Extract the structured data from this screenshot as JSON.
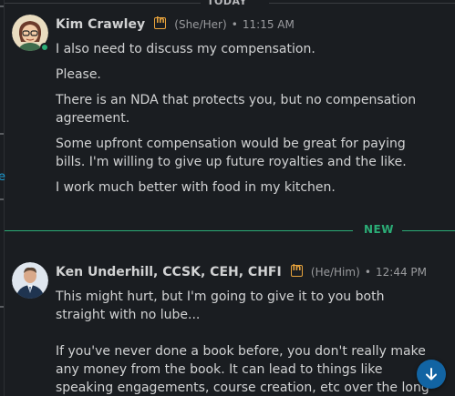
{
  "date_divider": {
    "label": "TODAY"
  },
  "edge": {
    "link_fragment": "e"
  },
  "messages": [
    {
      "author": "Kim Crawley",
      "badge": "in",
      "pronouns": "(She/Her)",
      "separator": "•",
      "time": "11:15 AM",
      "online": true,
      "paragraphs": [
        "I also need to discuss my compensation.",
        "Please.",
        "There is an NDA that protects you, but no compensation agreement.",
        "Some upfront compensation would be great for paying bills. I'm willing to give up future royalties and the like.",
        "I work much better with food in my kitchen."
      ]
    },
    {
      "author": "Ken Underhill, CCSK, CEH, CHFI",
      "badge": "in",
      "pronouns": "(He/Him)",
      "separator": "•",
      "time": "12:44 PM",
      "online": false,
      "paragraphs": [
        "This might hurt, but I'm going to give it to you both straight with no lube...",
        "If you've never done a book before, you don't really make any money from the book.  It can lead to things like speaking engagements, course creation, etc over the long"
      ]
    }
  ],
  "new_divider": {
    "label": "NEW"
  },
  "scroll_button": {
    "icon": "arrow-down-icon"
  },
  "colors": {
    "background": "#1a1d21",
    "new_divider": "#2bac76",
    "linkedin_badge": "#e8a33c",
    "scroll_button": "#1264a3"
  }
}
